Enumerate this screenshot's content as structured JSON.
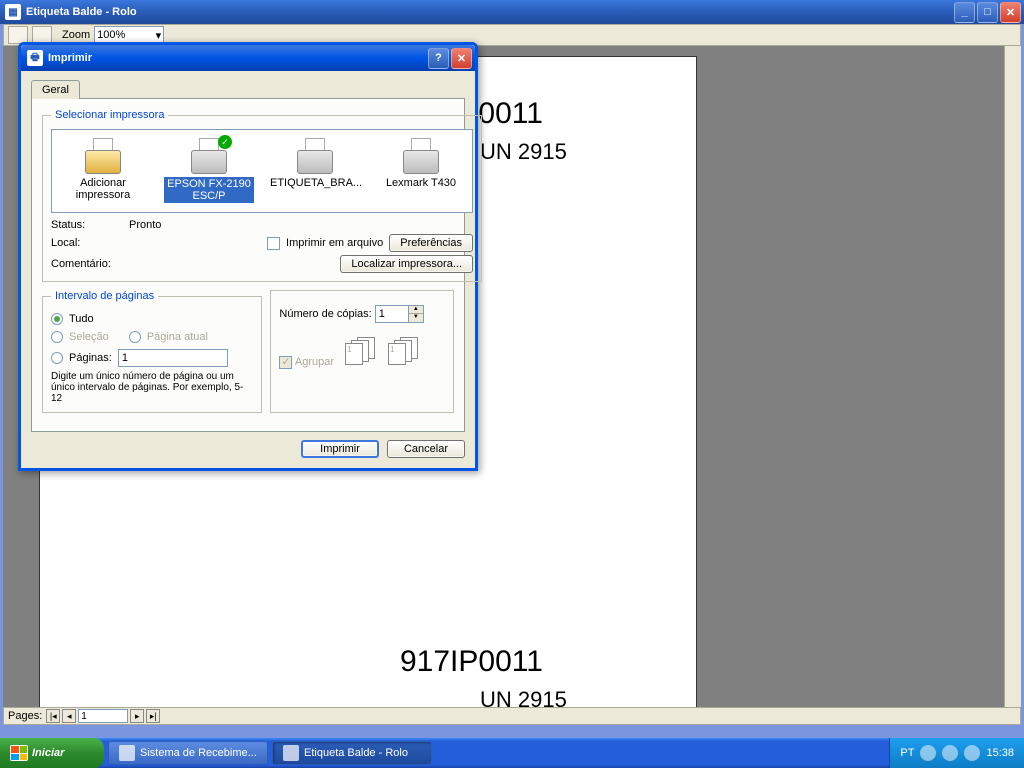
{
  "main_window": {
    "title": "Etiqueta Balde - Rolo"
  },
  "toolbar": {
    "zoom_label": "Zoom",
    "zoom_value": "100%"
  },
  "document": {
    "code1": "917IP0011",
    "un1": "UN 2915",
    "code2": "917IP0011",
    "un2": "UN 2915"
  },
  "pager": {
    "label": "Pages:",
    "value": "1"
  },
  "print_dialog": {
    "title": "Imprimir",
    "tab_general": "Geral",
    "group_select_printer": "Selecionar impressora",
    "printers": {
      "add": "Adicionar impressora",
      "epson": "EPSON FX-2190 ESC/P",
      "etiqueta": "ETIQUETA_BRA...",
      "lexmark": "Lexmark T430"
    },
    "status_label": "Status:",
    "status_value": "Pronto",
    "local_label": "Local:",
    "comment_label": "Comentário:",
    "print_to_file": "Imprimir em arquivo",
    "prefs_btn": "Preferências",
    "find_printer_btn": "Localizar impressora...",
    "group_page_range": "Intervalo de páginas",
    "radio_all": "Tudo",
    "radio_selection": "Seleção",
    "radio_current": "Página atual",
    "radio_pages": "Páginas:",
    "pages_value": "1",
    "pages_hint": "Digite um único número de página ou um único intervalo de páginas. Por exemplo, 5-12",
    "copies_label": "Número de cópias:",
    "copies_value": "1",
    "collate_label": "Agrupar",
    "btn_print": "Imprimir",
    "btn_cancel": "Cancelar"
  },
  "taskbar": {
    "start": "Iniciar",
    "task1": "Sistema de Recebime...",
    "task2": "Etiqueta Balde - Rolo",
    "lang": "PT",
    "time": "15:38"
  }
}
